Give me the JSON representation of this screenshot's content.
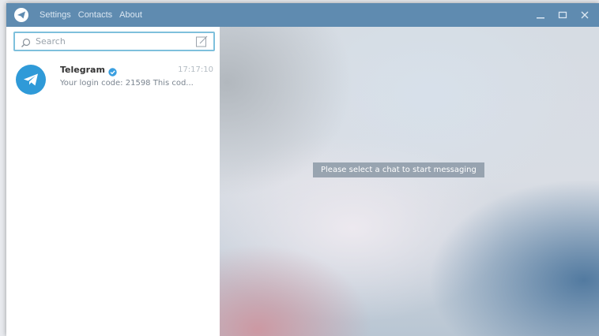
{
  "menu": {
    "settings": "Settings",
    "contacts": "Contacts",
    "about": "About"
  },
  "search": {
    "placeholder": "Search",
    "value": ""
  },
  "chats": [
    {
      "name": "Telegram",
      "verified": true,
      "time": "17:17:10",
      "preview": "Your login code: 21598  This cod...",
      "avatar_icon": "paper-plane-icon"
    }
  ],
  "main": {
    "empty_message": "Please select a chat to start messaging"
  },
  "colors": {
    "titlebar": "#5f8bb0",
    "accent": "#2f9ad8",
    "search_border": "#7ec0dc"
  }
}
